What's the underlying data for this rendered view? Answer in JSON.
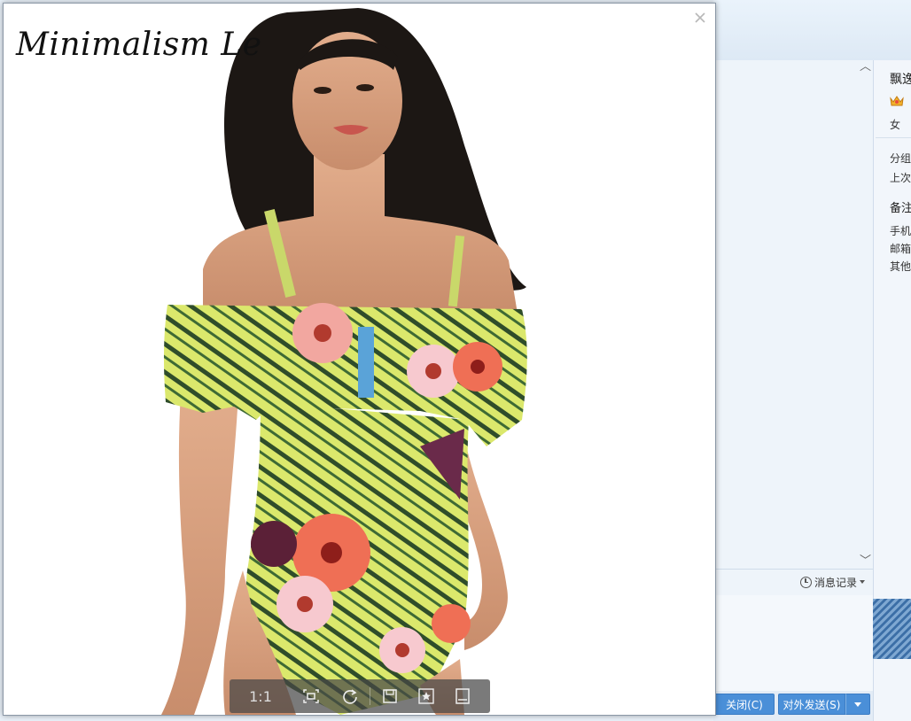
{
  "viewer": {
    "brand_text": "Minimalism Le",
    "toolbar": {
      "actual_size_label": "1:1"
    }
  },
  "chat": {
    "history_label": "消息记录",
    "close_label": "关闭(C)",
    "send_label": "对外发送(S)"
  },
  "profile_panel": {
    "name": "飘逸",
    "gender": "女",
    "group_label": "分组",
    "last_label": "上次",
    "remark_label": "备注",
    "phone_label": "手机",
    "email_label": "邮箱",
    "other_label": "其他"
  },
  "colors": {
    "button_blue": "#4a8fd8",
    "viewer_bg": "#ffffff"
  }
}
